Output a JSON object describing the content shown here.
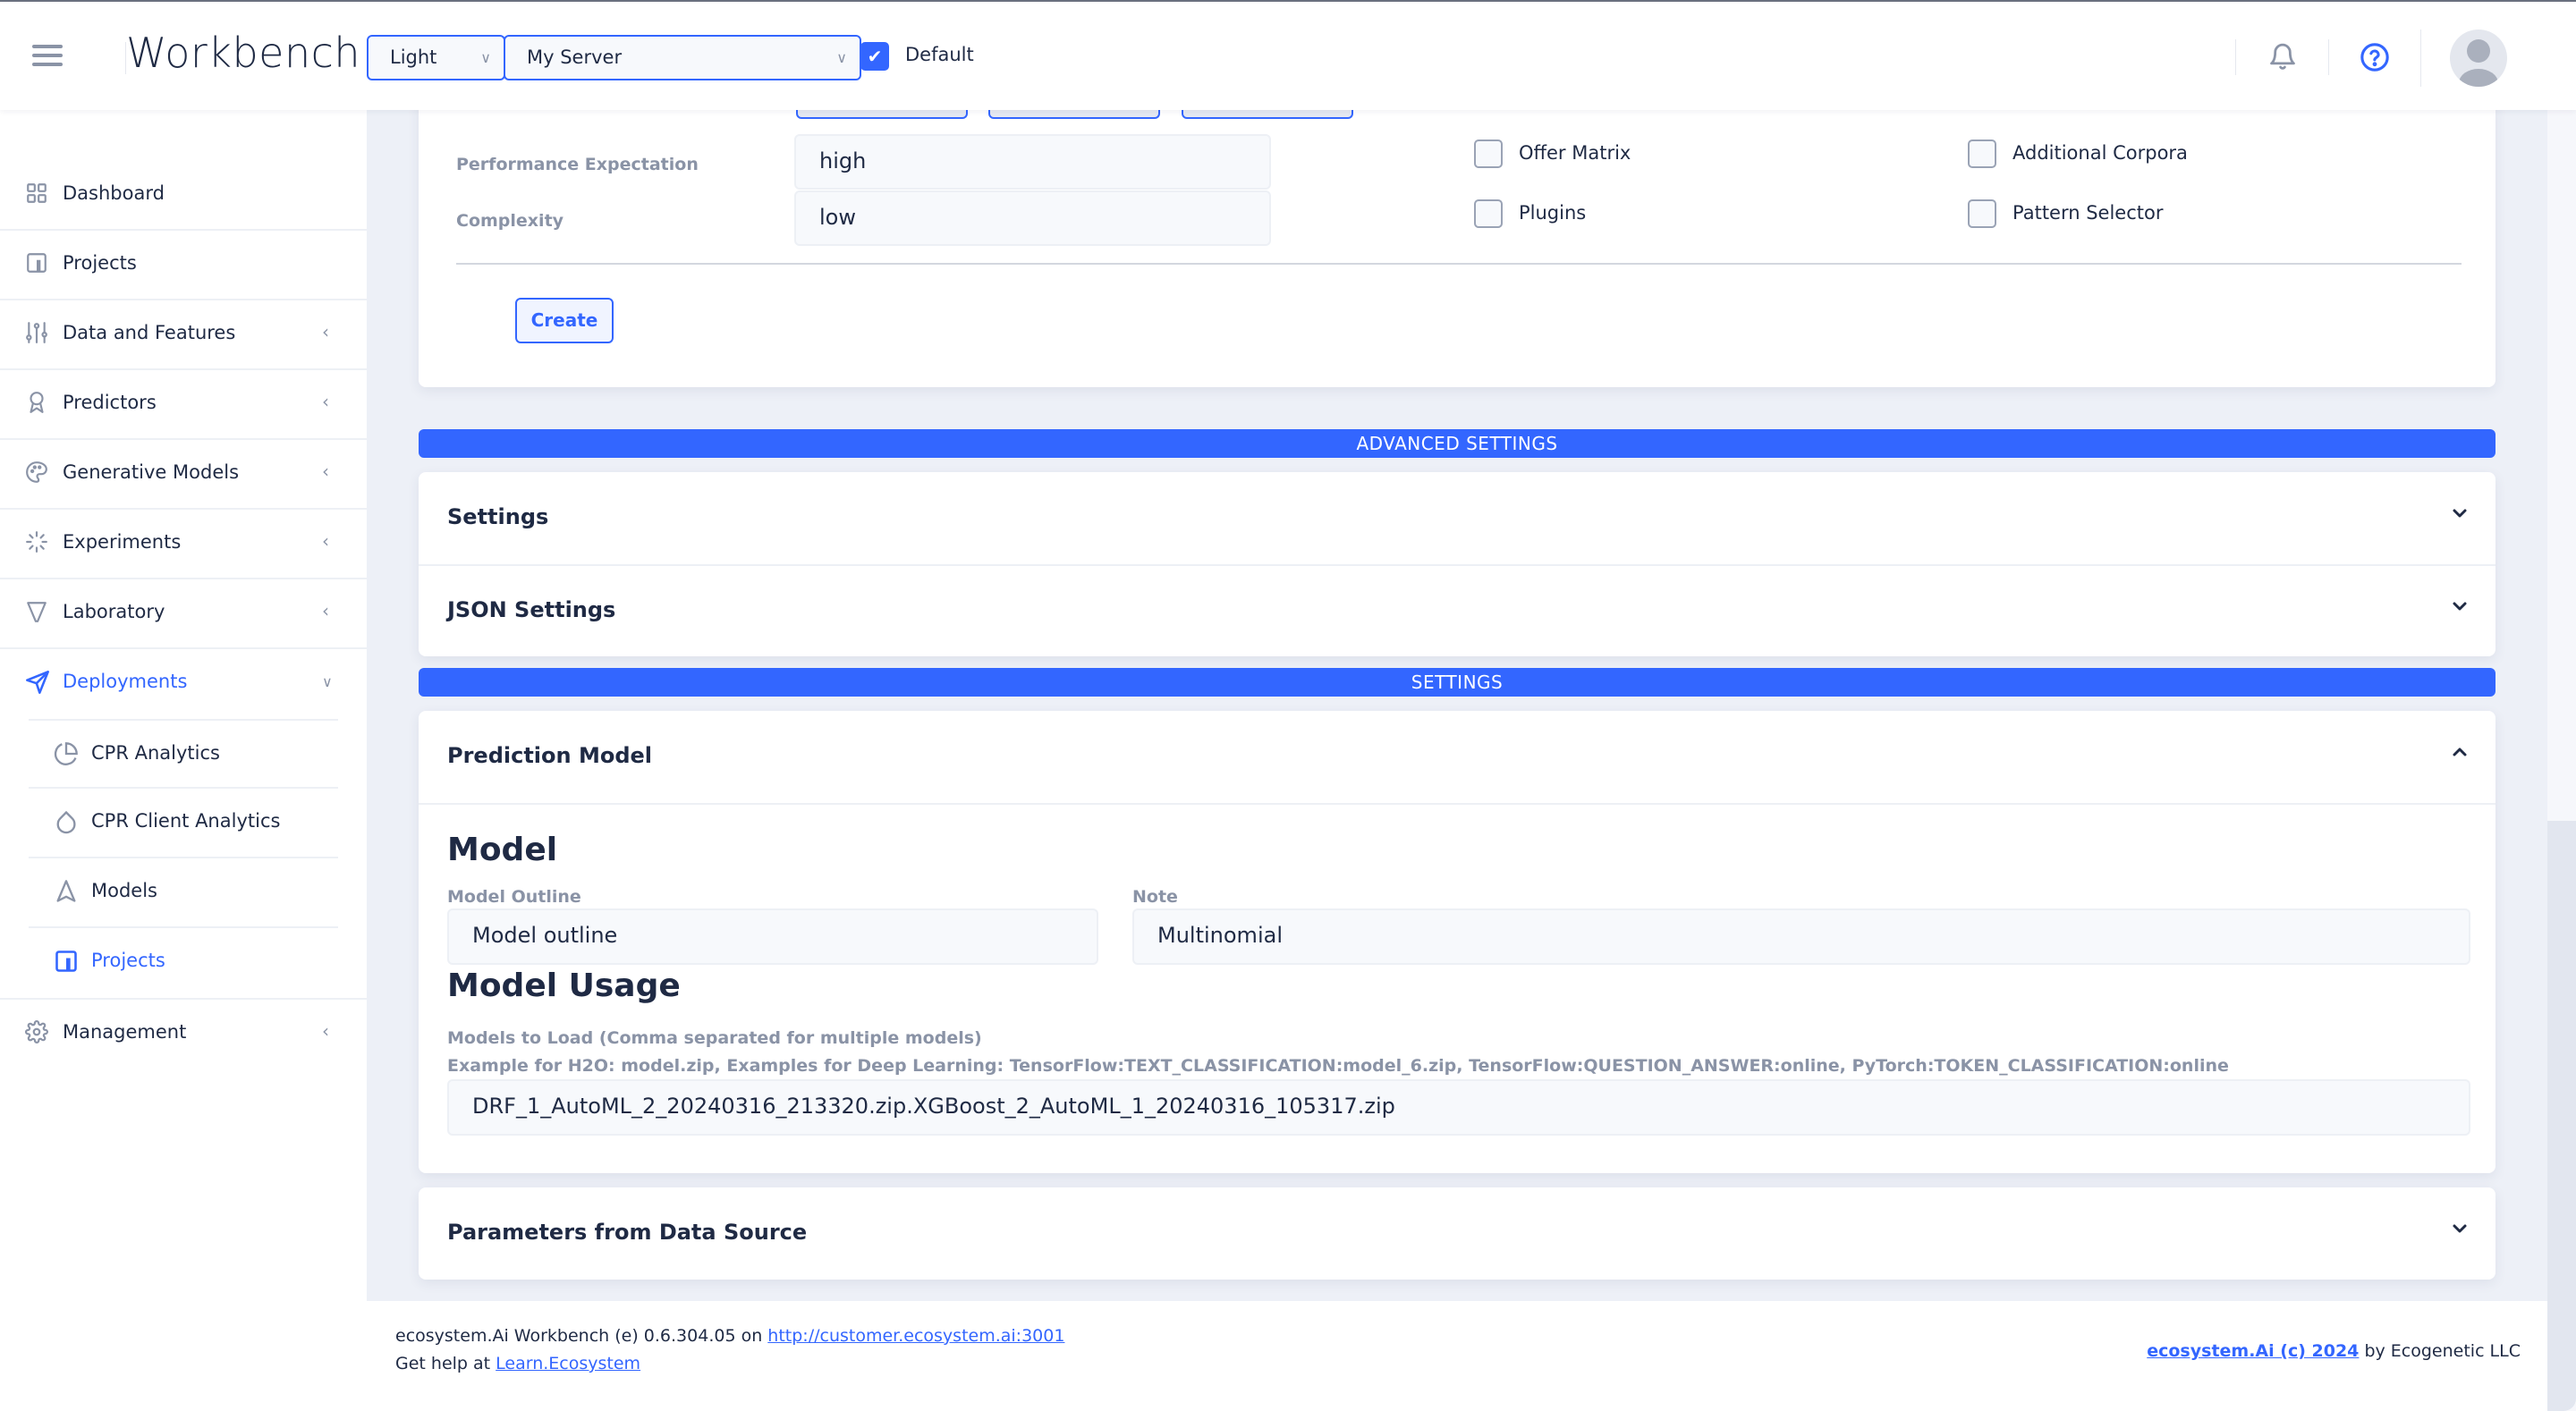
{
  "header": {
    "app_title": "Workbench",
    "theme_select": {
      "value": "Light"
    },
    "server_select": {
      "value": "My Server"
    },
    "default_checkbox": {
      "label": "Default",
      "checked": true
    },
    "icons": [
      "menu-icon",
      "bell-icon",
      "help-icon",
      "avatar-icon"
    ]
  },
  "sidebar": {
    "items": [
      {
        "label": "Dashboard",
        "icon": "dashboard-grid-icon",
        "expandable": false
      },
      {
        "label": "Projects",
        "icon": "projects-icon",
        "expandable": false
      },
      {
        "label": "Data and Features",
        "icon": "sliders-icon",
        "expandable": true
      },
      {
        "label": "Predictors",
        "icon": "award-icon",
        "expandable": true
      },
      {
        "label": "Generative Models",
        "icon": "palette-icon",
        "expandable": true
      },
      {
        "label": "Experiments",
        "icon": "loader-icon",
        "expandable": true
      },
      {
        "label": "Laboratory",
        "icon": "filter-icon",
        "expandable": true
      },
      {
        "label": "Deployments",
        "icon": "send-icon",
        "expandable": true,
        "expanded": true,
        "active": true
      },
      {
        "label": "Management",
        "icon": "gear-icon",
        "expandable": true
      }
    ],
    "deployments_children": [
      {
        "label": "CPR Analytics",
        "icon": "pie-chart-icon"
      },
      {
        "label": "CPR Client Analytics",
        "icon": "droplet-icon"
      },
      {
        "label": "Models",
        "icon": "navigation-icon"
      },
      {
        "label": "Projects",
        "icon": "projects-icon",
        "active": true
      }
    ]
  },
  "top_form": {
    "performance_expectation": {
      "label": "Performance Expectation",
      "value": "high"
    },
    "complexity": {
      "label": "Complexity",
      "value": "low"
    },
    "checkboxes": [
      {
        "label": "Offer Matrix",
        "checked": false
      },
      {
        "label": "Additional Corpora",
        "checked": false
      },
      {
        "label": "Plugins",
        "checked": false
      },
      {
        "label": "Pattern Selector",
        "checked": false
      }
    ],
    "create_button": "Create"
  },
  "advanced_settings": {
    "banner": "ADVANCED SETTINGS",
    "sections": [
      {
        "title": "Settings",
        "expanded": false
      },
      {
        "title": "JSON Settings",
        "expanded": false
      }
    ]
  },
  "settings": {
    "banner": "SETTINGS",
    "prediction_model": {
      "title": "Prediction Model",
      "expanded": true,
      "model_heading": "Model",
      "model_outline": {
        "label": "Model Outline",
        "value": "Model outline"
      },
      "note": {
        "label": "Note",
        "value": "Multinomial"
      },
      "usage_heading": "Model Usage",
      "models_to_load": {
        "label": "Models to Load (Comma separated for multiple models)",
        "hint": "Example for H2O: model.zip, Examples for Deep Learning: TensorFlow:TEXT_CLASSIFICATION:model_6.zip, TensorFlow:QUESTION_ANSWER:online, PyTorch:TOKEN_CLASSIFICATION:online",
        "value": "DRF_1_AutoML_2_20240316_213320.zip.XGBoost_2_AutoML_1_20240316_105317.zip"
      }
    },
    "parameters_from_data_source": {
      "title": "Parameters from Data Source",
      "expanded": false
    }
  },
  "footer": {
    "version_text": "ecosystem.Ai Workbench (e) 0.6.304.05 on",
    "server_link": "http://customer.ecosystem.ai:3001",
    "help_text": "Get help at",
    "help_link": "Learn.Ecosystem",
    "copyright_link": "ecosystem.Ai (c) 2024",
    "copyright_suffix": "by Ecogenetic LLC"
  },
  "colors": {
    "accent": "#3366ff",
    "text": "#1f2a44",
    "muted": "#8a93a6",
    "background": "#edf0f7"
  }
}
